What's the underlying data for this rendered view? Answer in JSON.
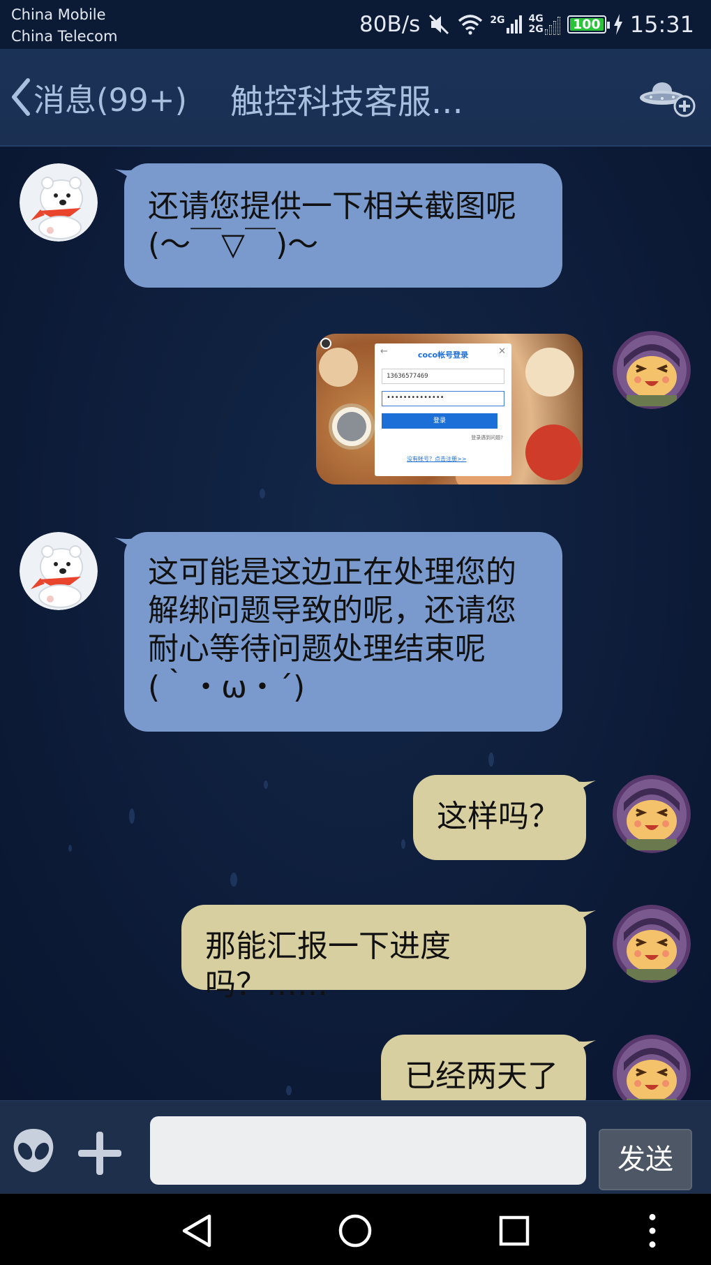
{
  "status": {
    "carrier1": "China Mobile",
    "carrier2": "China Telecom",
    "speed": "80B/s",
    "signal_top": "2G",
    "signal_mid": "4G",
    "signal_bot": "2G",
    "battery": "100",
    "time": "15:31"
  },
  "header": {
    "back_label": "消息(99+)",
    "title": "触控科技客服..."
  },
  "messages": [
    {
      "side": "left",
      "text": "还请您提供一下相关截图呢\n(～￣▽￣)～"
    },
    {
      "side": "right",
      "type": "image"
    },
    {
      "side": "left",
      "text": "这可能是这边正在处理您的\n解绑问题导致的呢，还请您\n耐心等待问题处理结束呢\n(｀・ω・´)"
    },
    {
      "side": "right",
      "text": "这样吗？"
    },
    {
      "side": "right",
      "text": "那能汇报一下进度吗？……"
    },
    {
      "side": "right",
      "text": "已经两天了"
    }
  ],
  "screenshot": {
    "login_title": "coco帐号登录",
    "phone": "13636577469",
    "password_mask": "••••••••••••••",
    "login_button": "登录",
    "help_link": "登录遇到问题?",
    "register_link": "没有帐号？点击注册>>"
  },
  "input": {
    "placeholder": "",
    "send_label": "发送"
  },
  "colors": {
    "left_bubble": "#7a99cc",
    "right_bubble": "#d8cfa1",
    "title_bar": "#1b3257"
  }
}
